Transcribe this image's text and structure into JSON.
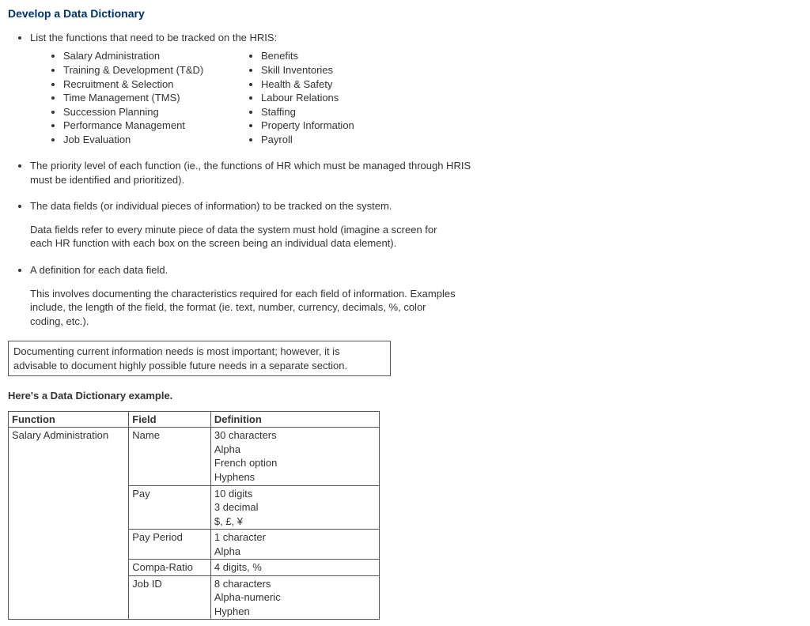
{
  "title": "Develop a Data Dictionary",
  "bullets": {
    "intro": "List the functions that need to be tracked on the HRIS:",
    "functions_a": [
      "Salary Administration",
      "Training & Development (T&D)",
      "Recruitment & Selection",
      "Time Management (TMS)",
      "Succession Planning",
      "Performance Management",
      "Job Evaluation"
    ],
    "functions_b": [
      "Benefits",
      "Skill Inventories",
      "Health & Safety",
      "Labour Relations",
      "Staffing",
      "Property Information",
      "Payroll"
    ],
    "priority": "The priority level of each function (ie., the functions of HR which must be managed through HRIS must be identified and prioritized).",
    "datafields": "The data fields (or individual pieces of information) to be tracked on the system.",
    "datafields_para": "Data fields refer to every minute piece of data the system must hold (imagine a screen for each HR function with each box on the screen being an individual data element).",
    "definition": "A definition for each data field.",
    "definition_para": "This involves documenting the characteristics required for each field of information. Examples include, the length of the field, the format (ie. text, number, currency, decimals, %, color coding, etc.)."
  },
  "note": "Documenting current information needs is most important; however, it is advisable to document highly possible future needs in a separate section.",
  "example_label": "Here's a Data Dictionary example.",
  "table": {
    "headers": {
      "function": "Function",
      "field": "Field",
      "definition": "Definition"
    },
    "function_value": "Salary Administration",
    "rows": [
      {
        "field": "Name",
        "def": [
          "30 characters",
          "Alpha",
          "French option",
          "Hyphens"
        ]
      },
      {
        "field": "Pay",
        "def": [
          "10 digits",
          "3 decimal",
          "$, £, ¥"
        ]
      },
      {
        "field": "Pay Period",
        "def": [
          "1 character",
          "Alpha"
        ]
      },
      {
        "field": "Compa-Ratio",
        "def": [
          "4 digits, %"
        ]
      },
      {
        "field": "Job ID",
        "def": [
          "8 characters",
          "Alpha-numeric",
          "Hyphen"
        ]
      }
    ]
  }
}
